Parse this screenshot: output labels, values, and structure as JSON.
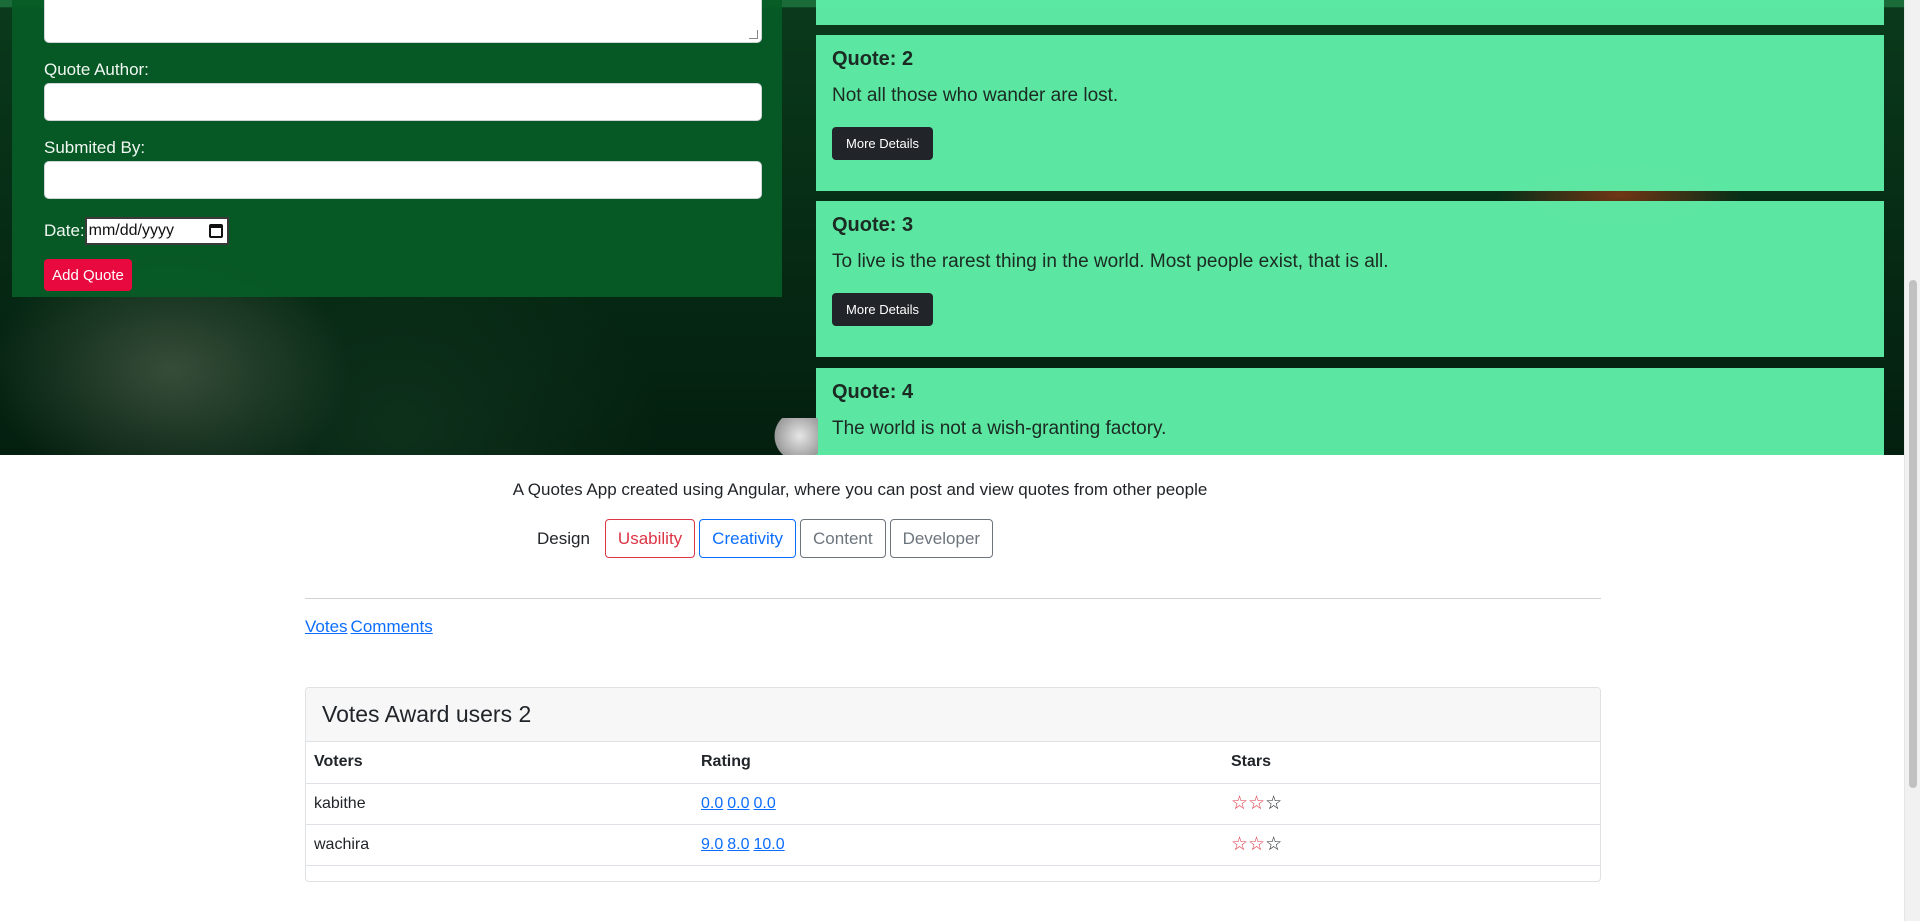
{
  "form": {
    "author_label": "Quote Author:",
    "author_value": "",
    "submitted_label": "Submited By:",
    "submitted_value": "",
    "date_label": "Date:",
    "date_placeholder": "mm/dd/yyyy",
    "add_button": "Add Quote"
  },
  "quotes": [
    {
      "label": "Quote:",
      "number": "2",
      "text": "Not all those who wander are lost.",
      "button": "More Details"
    },
    {
      "label": "Quote:",
      "number": "3",
      "text": "To live is the rarest thing in the world. Most people exist, that is all.",
      "button": "More Details"
    },
    {
      "label": "Quote:",
      "number": "4",
      "text": "The world is not a wish-granting factory.",
      "button": "More Details"
    }
  ],
  "about": {
    "description": "A Quotes App created using Angular, where you can post and view quotes from other people",
    "tags_label": "Design",
    "tags": [
      "Usability",
      "Creativity",
      "Content",
      "Developer"
    ]
  },
  "links": {
    "votes": "Votes",
    "comments": "Comments"
  },
  "votes": {
    "title": "Votes Award users 2",
    "columns": [
      "Voters",
      "Rating",
      "Stars"
    ],
    "rows": [
      {
        "voter": "kabithe",
        "ratings": [
          "0.0",
          "0.0",
          "0.0"
        ],
        "stars_filled": 2,
        "stars_total": 3
      },
      {
        "voter": "wachira",
        "ratings": [
          "9.0",
          "8.0",
          "10.0"
        ],
        "stars_filled": 2,
        "stars_total": 3
      }
    ]
  },
  "colors": {
    "hero_green": "#0a3a1c",
    "form_green": "#065c26",
    "card_mint": "#5eeca6",
    "danger": "#dc3545",
    "primary": "#0d6efd"
  }
}
